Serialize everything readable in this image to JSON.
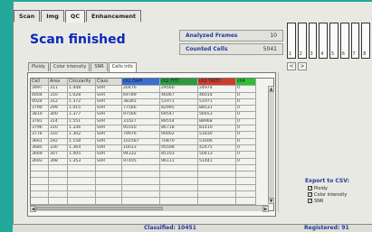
{
  "tabs": [
    "Scan",
    "Img",
    "QC",
    "Enhancement"
  ],
  "active_tab": "QC",
  "title": "Scan finished",
  "stats": [
    {
      "label": "Analyzed Frames",
      "value": "10"
    },
    {
      "label": "Counted Cells",
      "value": "5041"
    }
  ],
  "thumb_labels": [
    "1",
    "2",
    "3",
    "4",
    "5",
    "6",
    "7",
    "8"
  ],
  "nav": {
    "prev": "<",
    "next": ">"
  },
  "subtabs": [
    "Ploidy",
    "Color intensity",
    "SNR",
    "Cells info"
  ],
  "active_subtab": "Cells info",
  "table": {
    "headers": [
      "Cell",
      "Area",
      "Circularity",
      "Class",
      "ch1 DAPI",
      "ch2 FITC",
      "ch3 TRITC",
      "ch4"
    ],
    "header_colors": [
      "#dcdcd6",
      "#dcdcd6",
      "#dcdcd6",
      "#dcdcd6",
      "#3a6fd0",
      "#2a9d3a",
      "#d23a2a",
      "#2fbf2f"
    ],
    "rows": [
      [
        "3997",
        "311",
        "1.448",
        "SVR",
        "20476",
        "29560",
        "24974",
        "0"
      ],
      [
        "4004",
        "310",
        "1.028",
        "SVR",
        "69789",
        "46067",
        "46014",
        "0"
      ],
      [
        "4024",
        "312",
        "1.372",
        "SVR",
        "38365",
        "51971",
        "51971",
        "0"
      ],
      [
        "3790",
        "299",
        "1.415",
        "SVR",
        "77566",
        "82995",
        "88531",
        "0"
      ],
      [
        "3810",
        "300",
        "1.377",
        "SVR",
        "97566",
        "69547",
        "56653",
        "0"
      ],
      [
        "3781",
        "314",
        "1.551",
        "SVR",
        "31027",
        "89554",
        "88968",
        "0"
      ],
      [
        "3796",
        "310",
        "1.336",
        "SVR",
        "95550",
        "86718",
        "81410",
        "0"
      ],
      [
        "3776",
        "310",
        "1.302",
        "SVR",
        "79976",
        "90002",
        "51830",
        "0"
      ],
      [
        "3661",
        "192",
        "1.158",
        "SVR",
        "102587",
        "70870",
        "51606",
        "0"
      ],
      [
        "3685",
        "330",
        "1.364",
        "SVR",
        "10033",
        "95508",
        "42475",
        "0"
      ],
      [
        "3669",
        "307",
        "1.405",
        "SVR",
        "94332",
        "85103",
        "50413",
        "0"
      ],
      [
        "3693",
        "398",
        "1.353",
        "SVR",
        "97405",
        "96111",
        "51441",
        "0"
      ],
      [
        "",
        "",
        "",
        "",
        "",
        "",
        "",
        ""
      ],
      [
        "",
        "",
        "",
        "",
        "",
        "",
        "",
        ""
      ],
      [
        "",
        "",
        "",
        "",
        "",
        "",
        "",
        ""
      ],
      [
        "",
        "",
        "",
        "",
        "",
        "",
        "",
        ""
      ],
      [
        "",
        "",
        "",
        "",
        "",
        "",
        "",
        ""
      ],
      [
        "",
        "",
        "",
        "",
        "",
        "",
        "",
        ""
      ]
    ]
  },
  "export": {
    "heading": "Export to CSV:",
    "options": [
      "Ploidy",
      "Color intensity",
      "SNR"
    ]
  },
  "status": {
    "classified": "Classified: 10451",
    "registered": "Registered: 91"
  }
}
